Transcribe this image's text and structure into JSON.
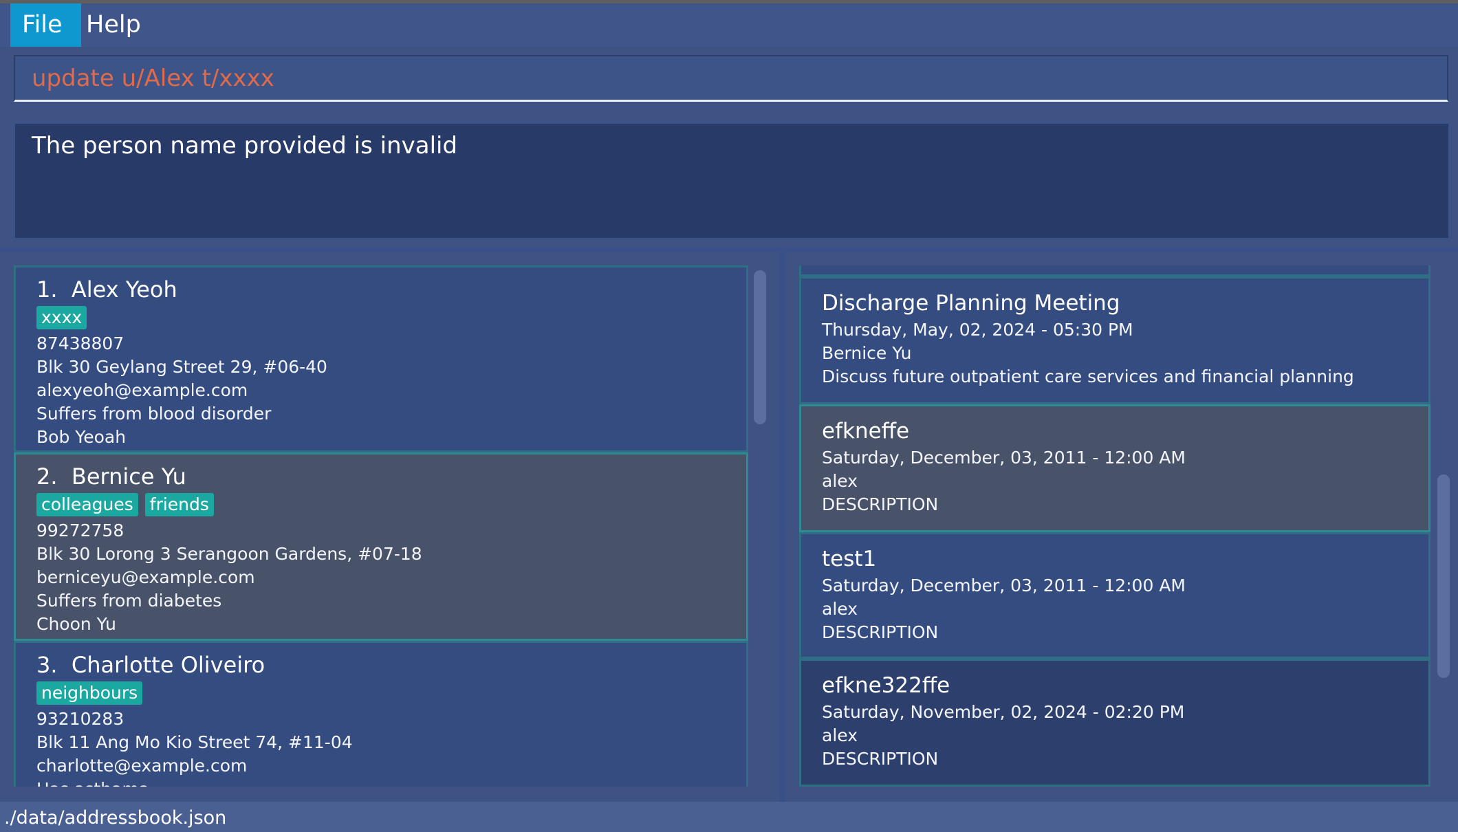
{
  "menu": {
    "file": "File",
    "help": "Help"
  },
  "command": {
    "value": "update u/Alex t/xxxx"
  },
  "result": {
    "message": "The person name provided is invalid"
  },
  "persons": [
    {
      "index": "1.",
      "name": "Alex Yeoh",
      "tags": [
        "xxxx"
      ],
      "phone": "87438807",
      "address": "Blk 30 Geylang Street 29, #06-40",
      "email": "alexyeoh@example.com",
      "condition": "Suffers from blood disorder",
      "next_of_kin": "Bob Yeoah"
    },
    {
      "index": "2.",
      "name": "Bernice Yu",
      "tags": [
        "colleagues",
        "friends"
      ],
      "phone": "99272758",
      "address": "Blk 30 Lorong 3 Serangoon Gardens, #07-18",
      "email": "berniceyu@example.com",
      "condition": "Suffers from diabetes",
      "next_of_kin": "Choon Yu"
    },
    {
      "index": "3.",
      "name": "Charlotte Oliveiro",
      "tags": [
        "neighbours"
      ],
      "phone": "93210283",
      "address": "Blk 11 Ang Mo Kio Street 74, #11-04",
      "email": "charlotte@example.com",
      "condition": "Has asthama"
    }
  ],
  "appointments": [
    {
      "title": "Discharge Planning Meeting",
      "datetime": "Thursday, May, 02, 2024 - 05:30 PM",
      "person": "Bernice Yu",
      "description": "Discuss future outpatient care services and financial planning"
    },
    {
      "title": "efkneffe",
      "datetime": "Saturday, December, 03, 2011 - 12:00 AM",
      "person": "alex",
      "description": "DESCRIPTION"
    },
    {
      "title": "test1",
      "datetime": "Saturday, December, 03, 2011 - 12:00 AM",
      "person": "alex",
      "description": "DESCRIPTION"
    },
    {
      "title": "efkne322ffe",
      "datetime": "Saturday, November, 02, 2024 - 02:20 PM",
      "person": "alex",
      "description": "DESCRIPTION"
    }
  ],
  "status": {
    "file_path": "./data/addressbook.json"
  },
  "colors": {
    "background": "#3e5384",
    "menu_active": "#0e98cf",
    "command_text": "#e06a4a",
    "tag": "#1ba8a0",
    "card_selected": "#48536a"
  }
}
